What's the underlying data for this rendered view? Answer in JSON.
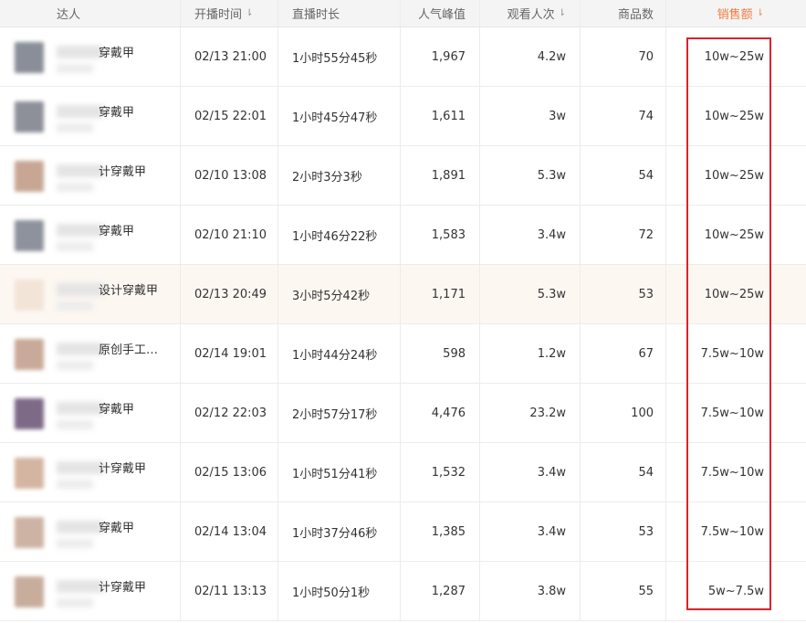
{
  "columns": {
    "name": "达人",
    "start_time": "开播时间",
    "duration": "直播时长",
    "peak": "人气峰值",
    "views": "观看人次",
    "products": "商品数",
    "sales": "销售额"
  },
  "rows": [
    {
      "name": "穿戴甲",
      "start_time": "02/13 21:00",
      "duration": "1小时55分45秒",
      "peak": "1,967",
      "views": "4.2w",
      "products": "70",
      "sales": "10w~25w",
      "avatar_color": "#8a8e99"
    },
    {
      "name": "穿戴甲",
      "start_time": "02/15 22:01",
      "duration": "1小时45分47秒",
      "peak": "1,611",
      "views": "3w",
      "products": "74",
      "sales": "10w~25w",
      "avatar_color": "#8d9099"
    },
    {
      "name": "计穿戴甲",
      "start_time": "02/10 13:08",
      "duration": "2小时3分3秒",
      "peak": "1,891",
      "views": "5.3w",
      "products": "54",
      "sales": "10w~25w",
      "avatar_color": "#c7a794"
    },
    {
      "name": "穿戴甲",
      "start_time": "02/10 21:10",
      "duration": "1小时46分22秒",
      "peak": "1,583",
      "views": "3.4w",
      "products": "72",
      "sales": "10w~25w",
      "avatar_color": "#8e929c"
    },
    {
      "name": "设计穿戴甲",
      "start_time": "02/13 20:49",
      "duration": "3小时5分42秒",
      "peak": "1,171",
      "views": "5.3w",
      "products": "53",
      "sales": "10w~25w",
      "avatar_color": "#f3e4d8"
    },
    {
      "name": "原创手工…",
      "start_time": "02/14 19:01",
      "duration": "1小时44分24秒",
      "peak": "598",
      "views": "1.2w",
      "products": "67",
      "sales": "7.5w~10w",
      "avatar_color": "#c9aa98"
    },
    {
      "name": "穿戴甲",
      "start_time": "02/12 22:03",
      "duration": "2小时57分17秒",
      "peak": "4,476",
      "views": "23.2w",
      "products": "100",
      "sales": "7.5w~10w",
      "avatar_color": "#7d6a86"
    },
    {
      "name": "计穿戴甲",
      "start_time": "02/15 13:06",
      "duration": "1小时51分41秒",
      "peak": "1,532",
      "views": "3.4w",
      "products": "54",
      "sales": "7.5w~10w",
      "avatar_color": "#d4b5a2"
    },
    {
      "name": "穿戴甲",
      "start_time": "02/14 13:04",
      "duration": "1小时37分46秒",
      "peak": "1,385",
      "views": "3.4w",
      "products": "53",
      "sales": "7.5w~10w",
      "avatar_color": "#cdb3a3"
    },
    {
      "name": "计穿戴甲",
      "start_time": "02/11 13:13",
      "duration": "1小时50分1秒",
      "peak": "1,287",
      "views": "3.8w",
      "products": "55",
      "sales": "5w~7.5w",
      "avatar_color": "#c8ad9d"
    }
  ],
  "highlight_color": "#d9232d",
  "active_sort_color": "#f07b3f"
}
